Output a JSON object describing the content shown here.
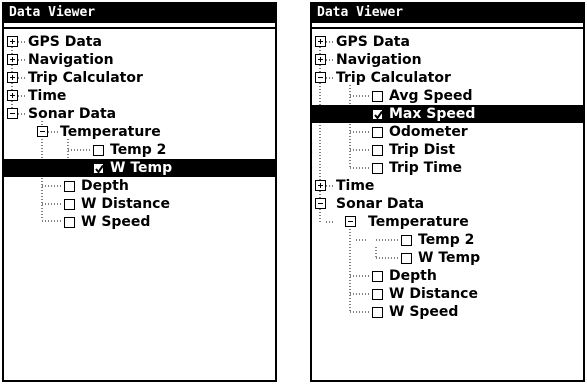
{
  "left_panel": {
    "title": "Data Viewer",
    "items": [
      {
        "label": "GPS Data"
      },
      {
        "label": "Navigation"
      },
      {
        "label": "Trip Calculator"
      },
      {
        "label": "Time"
      },
      {
        "label": "Sonar Data"
      },
      {
        "label": "Temperature"
      },
      {
        "label": "Temp 2"
      },
      {
        "label": "W Temp"
      },
      {
        "label": "Depth"
      },
      {
        "label": "W Distance"
      },
      {
        "label": "W Speed"
      }
    ]
  },
  "right_panel": {
    "title": "Data Viewer",
    "items": [
      {
        "label": "GPS Data"
      },
      {
        "label": "Navigation"
      },
      {
        "label": "Trip Calculator"
      },
      {
        "label": "Avg Speed"
      },
      {
        "label": "Max Speed"
      },
      {
        "label": "Odometer"
      },
      {
        "label": "Trip Dist"
      },
      {
        "label": "Trip Time"
      },
      {
        "label": "Time"
      },
      {
        "label": "Sonar Data"
      },
      {
        "label": "Temperature"
      },
      {
        "label": "Temp 2"
      },
      {
        "label": "W Temp"
      },
      {
        "label": "Depth"
      },
      {
        "label": "W Distance"
      },
      {
        "label": "W Speed"
      }
    ]
  }
}
